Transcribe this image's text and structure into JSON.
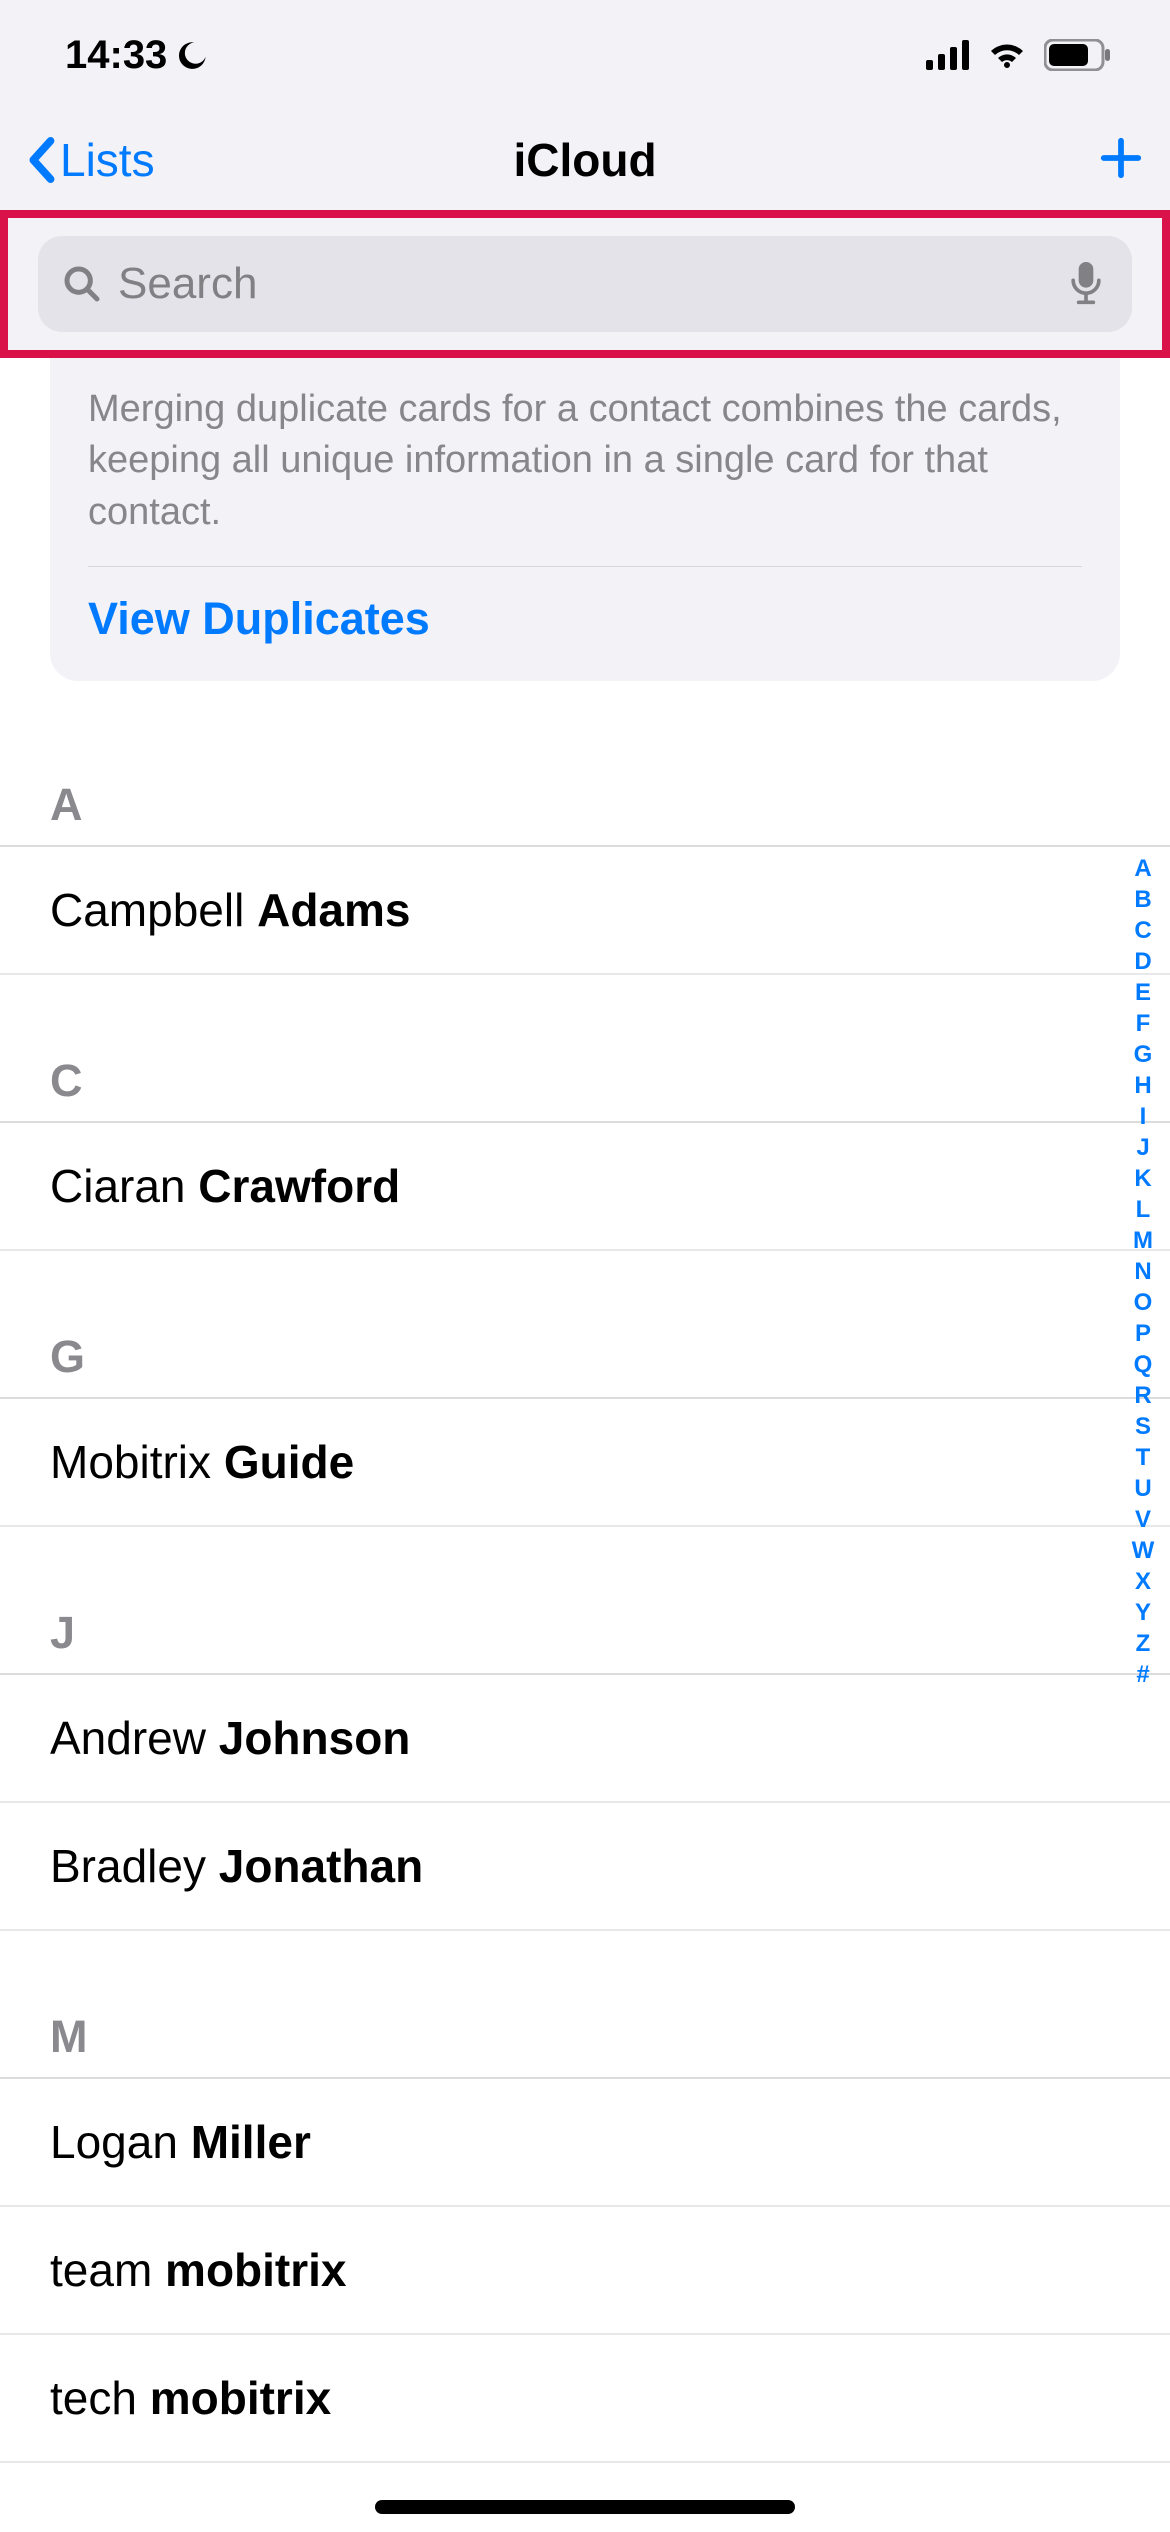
{
  "status": {
    "time": "14:33"
  },
  "nav": {
    "back_label": "Lists",
    "title": "iCloud"
  },
  "search": {
    "placeholder": "Search"
  },
  "duplicates": {
    "text": "Merging duplicate cards for a contact combines the cards, keeping all unique information in a single card for that contact.",
    "action": "View Duplicates"
  },
  "sections": [
    {
      "letter": "A",
      "contacts": [
        {
          "first": "Campbell",
          "last": "Adams"
        }
      ]
    },
    {
      "letter": "C",
      "contacts": [
        {
          "first": "Ciaran",
          "last": "Crawford"
        }
      ]
    },
    {
      "letter": "G",
      "contacts": [
        {
          "first": "Mobitrix",
          "last": "Guide"
        }
      ]
    },
    {
      "letter": "J",
      "contacts": [
        {
          "first": "Andrew",
          "last": "Johnson"
        },
        {
          "first": "Bradley",
          "last": "Jonathan"
        }
      ]
    },
    {
      "letter": "M",
      "contacts": [
        {
          "first": "Logan",
          "last": "Miller"
        },
        {
          "first": "team",
          "last": "mobitrix"
        },
        {
          "first": "tech",
          "last": "mobitrix"
        }
      ]
    }
  ],
  "index": [
    "A",
    "B",
    "C",
    "D",
    "E",
    "F",
    "G",
    "H",
    "I",
    "J",
    "K",
    "L",
    "M",
    "N",
    "O",
    "P",
    "Q",
    "R",
    "S",
    "T",
    "U",
    "V",
    "W",
    "X",
    "Y",
    "Z",
    "#"
  ]
}
